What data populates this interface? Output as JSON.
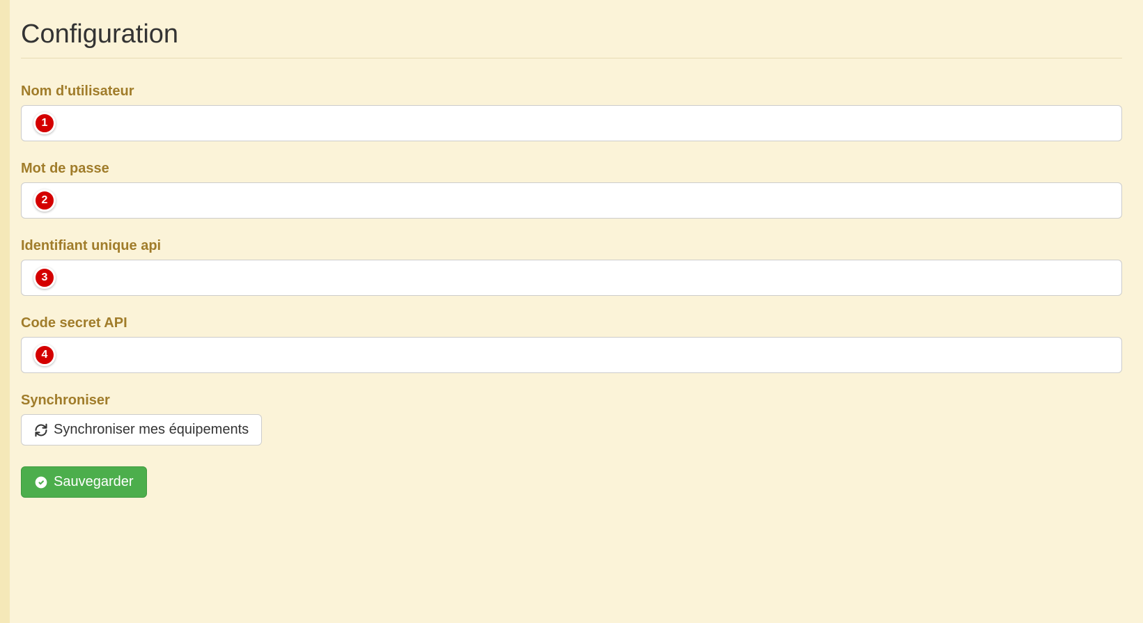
{
  "page": {
    "title": "Configuration"
  },
  "form": {
    "username": {
      "label": "Nom d'utilisateur",
      "value": "",
      "badge": "1"
    },
    "password": {
      "label": "Mot de passe",
      "value": "",
      "badge": "2"
    },
    "api_id": {
      "label": "Identifiant unique api",
      "value": "",
      "badge": "3"
    },
    "api_secret": {
      "label": "Code secret API",
      "value": "",
      "badge": "4"
    },
    "sync": {
      "label": "Synchroniser",
      "button_label": "Synchroniser mes équipements"
    }
  },
  "actions": {
    "save_label": "Sauvegarder"
  }
}
